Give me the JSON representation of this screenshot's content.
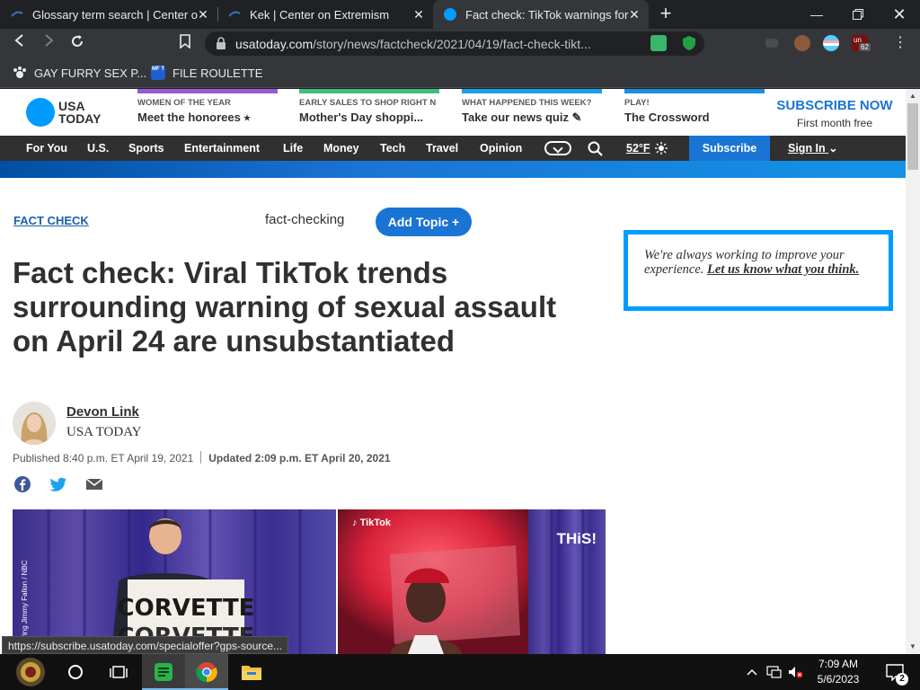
{
  "browser": {
    "tabs": [
      {
        "title": "Glossary term search | Center o",
        "active": false
      },
      {
        "title": "Kek | Center on Extremism",
        "active": false
      },
      {
        "title": "Fact check: TikTok warnings for",
        "active": true
      }
    ],
    "url_domain": "usatoday.com",
    "url_path": "/story/news/factcheck/2021/04/19/fact-check-tikt...",
    "bookmarks": [
      {
        "label": "GAY FURRY SEX P..."
      },
      {
        "label": "FILE ROULETTE",
        "icon_text": "MF T"
      }
    ],
    "extension_badge": "62",
    "extension_label": "un",
    "status_url": "https://subscribe.usatoday.com/specialoffer?gps-source..."
  },
  "site": {
    "logo_line1": "USA",
    "logo_line2": "TODAY",
    "promos": [
      {
        "kicker": "WOMEN OF THE YEAR",
        "title": "Meet the honorees ⭑",
        "color": "#9b59d0"
      },
      {
        "kicker": "EARLY SALES TO SHOP RIGHT N",
        "title": "Mother's Day shoppi...",
        "color": "#3fbf7f"
      },
      {
        "kicker": "WHAT HAPPENED THIS WEEK?",
        "title": "Take our news quiz",
        "color": "#1aa0e8"
      },
      {
        "kicker": "PLAY!",
        "title": "The Crossword",
        "color": "#1a8fe0"
      }
    ],
    "subscribe_now": "SUBSCRIBE NOW",
    "first_month": "First month free",
    "nav": [
      "For You",
      "U.S.",
      "Sports",
      "Entertainment",
      "Life",
      "Money",
      "Tech",
      "Travel",
      "Opinion"
    ],
    "weather": "52°F",
    "subscribe": "Subscribe",
    "sign_in": "Sign In"
  },
  "article": {
    "section": "FACT CHECK",
    "topic": "fact-checking",
    "add_topic": "Add Topic +",
    "headline": "Fact check: Viral TikTok trends surrounding warning of sexual assault on April 24 are unsubstantiated",
    "author": "Devon Link",
    "organization": "USA TODAY",
    "published": "Published 8:40 p.m. ET April 19, 2021",
    "updated": "Updated 2:09 p.m. ET April 20, 2021",
    "image_left_sign": "CORVETTE",
    "image_left_credit": "starring Jimmy Fallon / NBC",
    "image_right_brand": "TikTok",
    "image_right_caption": "THiS!"
  },
  "sidebar": {
    "feedback_text": "We're always working to improve your experience.",
    "feedback_link": "Let us know what you think."
  },
  "taskbar": {
    "time": "7:09 AM",
    "date": "5/6/2023",
    "notification_count": "2"
  }
}
